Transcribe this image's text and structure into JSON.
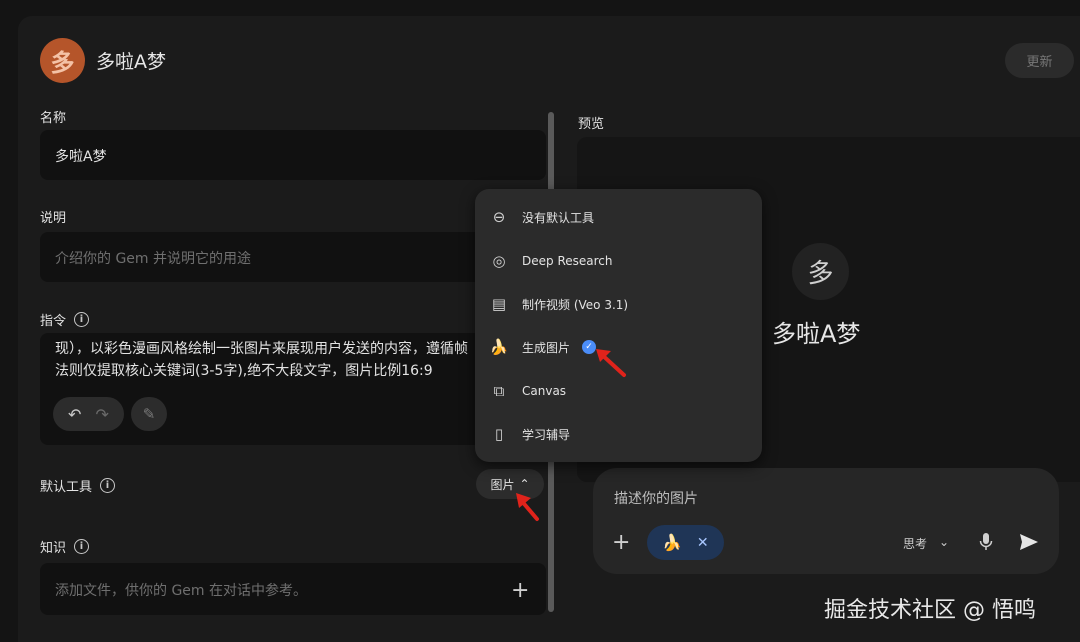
{
  "header": {
    "avatar_char": "多",
    "title": "多啦A梦",
    "update_label": "更新"
  },
  "form": {
    "name_label": "名称",
    "name_value": "多啦A梦",
    "desc_label": "说明",
    "desc_placeholder": "介绍你的 Gem 并说明它的用途",
    "instr_label": "指令",
    "instr_text": "现），以彩色漫画风格绘制一张图片来展现用户发送的内容，遵循帧\n法则仅提取核心关键词(3-5字),绝不大段文字，图片比例16:9",
    "default_tool_label": "默认工具",
    "default_tool_value": "图片",
    "knowledge_label": "知识",
    "knowledge_placeholder": "添加文件，供你的 Gem 在对话中参考。"
  },
  "preview": {
    "label": "预览",
    "avatar_char": "多",
    "name": "多啦A梦",
    "chat_placeholder": "描述你的图片",
    "think_label": "思考"
  },
  "menu": {
    "items": [
      {
        "label": "没有默认工具",
        "icon": "no-tool-icon"
      },
      {
        "label": "Deep Research",
        "icon": "deep-research-icon"
      },
      {
        "label": "制作视频 (Veo 3.1)",
        "icon": "video-icon"
      },
      {
        "label": "生成图片",
        "icon": "banana-icon",
        "selected": true
      },
      {
        "label": "Canvas",
        "icon": "canvas-icon"
      },
      {
        "label": "学习辅导",
        "icon": "book-icon"
      }
    ]
  },
  "watermark": "掘金技术社区 @ 悟鸣",
  "colors": {
    "accent_blue": "#4b8df8",
    "arrow_red": "#e0231b",
    "avatar_orange": "#b5552a"
  }
}
